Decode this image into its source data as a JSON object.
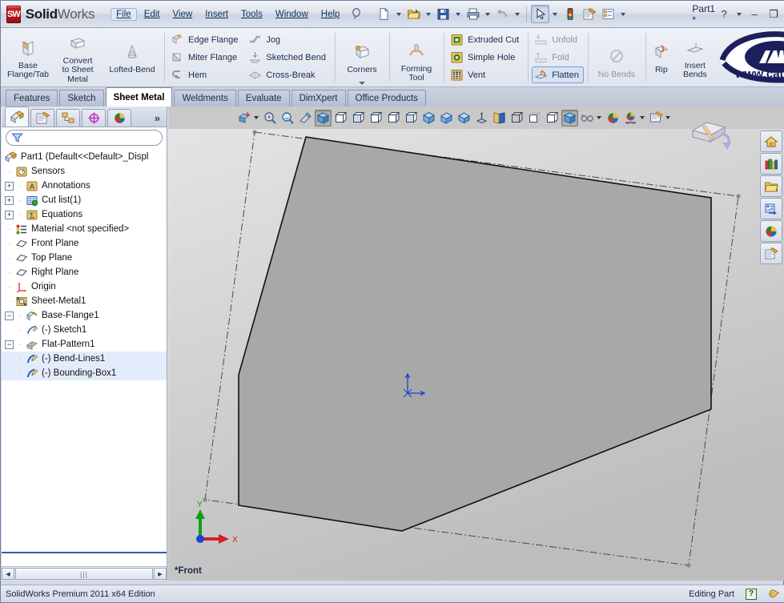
{
  "app": {
    "brand_bold": "Solid",
    "brand_light": "Works",
    "logo_text": "SW",
    "document_title": "Part1 *"
  },
  "menubar": {
    "items": [
      {
        "label": "File",
        "active": true
      },
      {
        "label": "Edit",
        "active": false
      },
      {
        "label": "View",
        "active": false
      },
      {
        "label": "Insert",
        "active": false
      },
      {
        "label": "Tools",
        "active": false
      },
      {
        "label": "Window",
        "active": false
      },
      {
        "label": "Help",
        "active": false
      }
    ],
    "search_icon": "magnifier-icon"
  },
  "quick_toolbar": {
    "buttons": [
      {
        "name": "new-document-button",
        "icon": "new-file-icon",
        "has_caret": true
      },
      {
        "name": "open-document-button",
        "icon": "open-folder-icon",
        "has_caret": true
      },
      {
        "name": "save-button",
        "icon": "save-disk-icon",
        "has_caret": true
      },
      {
        "name": "print-button",
        "icon": "printer-icon",
        "has_caret": true
      },
      {
        "name": "undo-button",
        "icon": "undo-arrow-icon",
        "has_caret": true
      },
      {
        "name": "select-button",
        "icon": "cursor-arrow-icon",
        "has_caret": true,
        "pressed": true
      },
      {
        "name": "rebuild-button",
        "icon": "traffic-light-icon",
        "has_caret": false
      },
      {
        "name": "options-button",
        "icon": "options-gear-icon",
        "has_caret": false
      },
      {
        "name": "display-options-button",
        "icon": "list-settings-icon",
        "has_caret": true
      }
    ]
  },
  "window_controls": {
    "help": "?",
    "help_caret": true,
    "minimize": "–",
    "maximize": "❐",
    "close": "✕"
  },
  "ribbon": {
    "groups": [
      {
        "name": "base-group",
        "big_buttons": [
          {
            "name": "base-flange-tab-button",
            "label": "Base\nFlange/Tab",
            "icon": "base-flange-icon"
          },
          {
            "name": "convert-to-sheet-metal-button",
            "label": "Convert\nto Sheet\nMetal",
            "icon": "convert-sheet-metal-icon"
          },
          {
            "name": "lofted-bend-button",
            "label": "Lofted-Bend",
            "icon": "lofted-bend-icon"
          }
        ]
      },
      {
        "name": "flange-group",
        "small_columns": [
          [
            {
              "name": "edge-flange-button",
              "label": "Edge Flange",
              "icon": "edge-flange-icon",
              "state": "normal"
            },
            {
              "name": "miter-flange-button",
              "label": "Miter Flange",
              "icon": "miter-flange-icon",
              "state": "normal"
            },
            {
              "name": "hem-button",
              "label": "Hem",
              "icon": "hem-icon",
              "state": "normal"
            }
          ],
          [
            {
              "name": "jog-button",
              "label": "Jog",
              "icon": "jog-icon",
              "state": "normal"
            },
            {
              "name": "sketched-bend-button",
              "label": "Sketched Bend",
              "icon": "sketched-bend-icon",
              "state": "normal"
            },
            {
              "name": "cross-break-button",
              "label": "Cross-Break",
              "icon": "cross-break-icon",
              "state": "normal"
            }
          ]
        ]
      },
      {
        "name": "corners-group",
        "big_buttons": [
          {
            "name": "corners-button",
            "label": "Corners",
            "icon": "corners-icon",
            "has_dropdown": true
          }
        ]
      },
      {
        "name": "forming-tool-group",
        "big_buttons": [
          {
            "name": "forming-tool-button",
            "label": "Forming\nTool",
            "icon": "forming-tool-icon"
          }
        ]
      },
      {
        "name": "cut-group",
        "small_columns": [
          [
            {
              "name": "extruded-cut-button",
              "label": "Extruded Cut",
              "icon": "extruded-cut-icon",
              "state": "normal"
            },
            {
              "name": "simple-hole-button",
              "label": "Simple Hole",
              "icon": "simple-hole-icon",
              "state": "normal"
            },
            {
              "name": "vent-button",
              "label": "Vent",
              "icon": "vent-icon",
              "state": "normal"
            }
          ]
        ]
      },
      {
        "name": "fold-group",
        "small_columns": [
          [
            {
              "name": "unfold-button",
              "label": "Unfold",
              "icon": "unfold-icon",
              "state": "dim"
            },
            {
              "name": "fold-button",
              "label": "Fold",
              "icon": "fold-icon",
              "state": "dim"
            },
            {
              "name": "flatten-button",
              "label": "Flatten",
              "icon": "flatten-icon",
              "state": "active"
            }
          ]
        ]
      },
      {
        "name": "no-bends-group",
        "big_buttons": [
          {
            "name": "no-bends-button",
            "label": "No Bends",
            "icon": "no-bends-icon",
            "dim": true
          }
        ]
      },
      {
        "name": "rip-group",
        "big_buttons": [
          {
            "name": "rip-button",
            "label": "Rip",
            "icon": "rip-icon"
          },
          {
            "name": "insert-bends-button",
            "label": "Insert\nBends",
            "icon": "insert-bends-icon"
          }
        ]
      }
    ],
    "logo": {
      "name": "cati-logo",
      "text": "www.cati.com",
      "color": "#1c1f5c"
    }
  },
  "command_tabs": {
    "items": [
      {
        "label": "Features",
        "selected": false
      },
      {
        "label": "Sketch",
        "selected": false
      },
      {
        "label": "Sheet Metal",
        "selected": true
      },
      {
        "label": "Weldments",
        "selected": false
      },
      {
        "label": "Evaluate",
        "selected": false
      },
      {
        "label": "DimXpert",
        "selected": false
      },
      {
        "label": "Office Products",
        "selected": false
      }
    ]
  },
  "feature_manager": {
    "tabs": [
      {
        "name": "feature-tree-tab",
        "icon": "feature-tree-icon",
        "selected": true
      },
      {
        "name": "property-manager-tab",
        "icon": "property-manager-icon",
        "selected": false
      },
      {
        "name": "configuration-manager-tab",
        "icon": "configuration-icon",
        "selected": false
      },
      {
        "name": "dimxpert-manager-tab",
        "icon": "dimxpert-target-icon",
        "selected": false
      },
      {
        "name": "display-manager-tab",
        "icon": "appearance-sphere-icon",
        "selected": false
      }
    ],
    "more_label": "»",
    "filter": {
      "icon": "filter-funnel-icon",
      "placeholder": "",
      "value": ""
    },
    "tree": [
      {
        "label": "Part1  (Default<<Default>_Displ",
        "icon": "part-icon",
        "indent": 0,
        "expander": "none",
        "selected": false
      },
      {
        "label": "Sensors",
        "icon": "sensors-icon",
        "indent": 1,
        "expander": "none",
        "selected": false
      },
      {
        "label": "Annotations",
        "icon": "annotations-icon",
        "indent": 1,
        "expander": "plus",
        "selected": false
      },
      {
        "label": "Cut list(1)",
        "icon": "cutlist-icon",
        "indent": 1,
        "expander": "plus",
        "selected": false
      },
      {
        "label": "Equations",
        "icon": "equations-icon",
        "indent": 1,
        "expander": "plus",
        "selected": false
      },
      {
        "label": "Material <not specified>",
        "icon": "material-icon",
        "indent": 1,
        "expander": "none",
        "selected": false
      },
      {
        "label": "Front Plane",
        "icon": "plane-icon",
        "indent": 1,
        "expander": "none",
        "selected": false
      },
      {
        "label": "Top Plane",
        "icon": "plane-icon",
        "indent": 1,
        "expander": "none",
        "selected": false
      },
      {
        "label": "Right Plane",
        "icon": "plane-icon",
        "indent": 1,
        "expander": "none",
        "selected": false
      },
      {
        "label": "Origin",
        "icon": "origin-icon",
        "indent": 1,
        "expander": "none",
        "selected": false
      },
      {
        "label": "Sheet-Metal1",
        "icon": "sheet-metal-icon",
        "indent": 1,
        "expander": "none",
        "selected": false
      },
      {
        "label": "Base-Flange1",
        "icon": "base-flange-tree-icon",
        "indent": 1,
        "expander": "minus",
        "selected": false
      },
      {
        "label": "(-) Sketch1",
        "icon": "sketch-icon",
        "indent": 2,
        "expander": "none",
        "selected": false
      },
      {
        "label": "Flat-Pattern1",
        "icon": "flat-pattern-icon",
        "indent": 1,
        "expander": "minus",
        "selected": false
      },
      {
        "label": "(-) Bend-Lines1",
        "icon": "bend-lines-icon",
        "indent": 2,
        "expander": "none",
        "selected": true
      },
      {
        "label": "(-) Bounding-Box1",
        "icon": "bounding-box-icon",
        "indent": 2,
        "expander": "none",
        "selected": true
      }
    ],
    "scrollbar": {
      "left_arrow": "◀",
      "right_arrow": "▶",
      "grip": "|||"
    }
  },
  "view_toolbar": {
    "buttons": [
      {
        "name": "zoom-to-fit-button",
        "icon": "zoom-fit-icon",
        "has_caret": true,
        "pressed": false
      },
      {
        "name": "zoom-to-area-button",
        "icon": "zoom-area-icon",
        "has_caret": false,
        "pressed": false
      },
      {
        "name": "previous-view-button",
        "icon": "previous-view-icon",
        "has_caret": false,
        "pressed": false
      },
      {
        "name": "section-view-button",
        "icon": "section-view-icon",
        "has_caret": false,
        "pressed": false
      },
      {
        "name": "view-orientation-button",
        "icon": "view-orientation-icon",
        "has_caret": false,
        "pressed": true
      },
      {
        "name": "front-view-button",
        "icon": "cube-front-icon",
        "has_caret": false,
        "pressed": false
      },
      {
        "name": "back-view-button",
        "icon": "cube-back-icon",
        "has_caret": false,
        "pressed": false
      },
      {
        "name": "left-view-button",
        "icon": "cube-left-icon",
        "has_caret": false,
        "pressed": false
      },
      {
        "name": "right-view-button",
        "icon": "cube-right-icon",
        "has_caret": false,
        "pressed": false
      },
      {
        "name": "top-view-button",
        "icon": "cube-top-icon",
        "has_caret": false,
        "pressed": false
      },
      {
        "name": "isometric-view-button",
        "icon": "cube-iso-icon",
        "has_caret": false,
        "pressed": false
      },
      {
        "name": "trimetric-view-button",
        "icon": "cube-trimetric-icon",
        "has_caret": false,
        "pressed": false
      },
      {
        "name": "dimetric-view-button",
        "icon": "cube-dimetric-icon",
        "has_caret": false,
        "pressed": false
      },
      {
        "name": "normal-to-button",
        "icon": "normal-to-icon",
        "has_caret": false,
        "pressed": false
      },
      {
        "name": "display-style-book-button",
        "icon": "open-book-icon",
        "has_caret": false,
        "pressed": false
      },
      {
        "name": "wireframe-button",
        "icon": "wireframe-icon",
        "has_caret": false,
        "pressed": false
      },
      {
        "name": "hidden-lines-visible-button",
        "icon": "hidden-lines-visible-icon",
        "has_caret": false,
        "pressed": false
      },
      {
        "name": "hidden-lines-removed-button",
        "icon": "hidden-lines-removed-icon",
        "has_caret": false,
        "pressed": false
      },
      {
        "name": "shaded-button",
        "icon": "shaded-icon",
        "has_caret": false,
        "pressed": false
      },
      {
        "name": "shaded-with-edges-button",
        "icon": "shaded-with-edges-icon",
        "has_caret": false,
        "pressed": true
      },
      {
        "name": "hide-show-items-button",
        "icon": "glasses-icon",
        "has_caret": true,
        "pressed": false
      },
      {
        "name": "apply-scene-button",
        "icon": "scene-sphere-icon",
        "has_caret": false,
        "pressed": false
      },
      {
        "name": "view-settings-button",
        "icon": "view-settings-sphere-icon",
        "has_caret": true,
        "pressed": false
      },
      {
        "name": "viewport-button",
        "icon": "viewport-icon",
        "has_caret": true,
        "pressed": false
      }
    ]
  },
  "document_window_controls": {
    "minimize": "–",
    "restore": "❐",
    "close": "✕"
  },
  "graphics": {
    "view_label": "*Front",
    "background_color": "#c9c9c9",
    "part_fill": "#a8a8a8",
    "part_edge": "#111111",
    "bounding_box_style": "dash-dot",
    "triad": {
      "x_label": "X",
      "y_label": "Y",
      "x_color": "#d42020",
      "y_color": "#12a012"
    },
    "origin_marker_color": "#1b3fd6",
    "flat_pattern_indicator": "flat-pattern-rotate-icon"
  },
  "task_pane": {
    "buttons": [
      {
        "name": "solidworks-resources-button",
        "icon": "home-icon"
      },
      {
        "name": "design-library-button",
        "icon": "design-library-icon"
      },
      {
        "name": "file-explorer-button",
        "icon": "folder-icon"
      },
      {
        "name": "search-button",
        "icon": "search-properties-icon"
      },
      {
        "name": "appearances-scenes-button",
        "icon": "appearance-sphere-icon"
      },
      {
        "name": "custom-properties-button",
        "icon": "custom-properties-icon"
      }
    ]
  },
  "status_bar": {
    "edition": "SolidWorks Premium 2011 x64 Edition",
    "mode": "Editing Part",
    "help_badge": "?",
    "tag_icon": "tag-icon"
  }
}
